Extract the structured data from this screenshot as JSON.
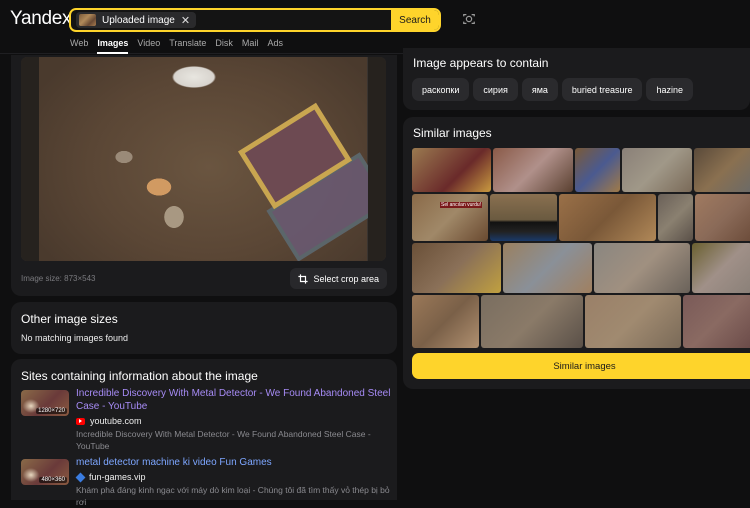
{
  "header": {
    "logo": "Yandex",
    "search_chip_label": "Uploaded image",
    "search_chip_close": "✕",
    "search_button": "Search",
    "nav": [
      "Web",
      "Images",
      "Video",
      "Translate",
      "Disk",
      "Mail",
      "Ads"
    ],
    "nav_active": "Images"
  },
  "main_image": {
    "size_label": "Image size: 873×543",
    "crop_button": "Select crop area"
  },
  "other_sizes": {
    "title": "Other image sizes",
    "message": "No matching images found"
  },
  "sites": {
    "title": "Sites containing information about the image",
    "items": [
      {
        "thumb_size": "1280×720",
        "title": "Incredible Discovery With Metal Detector - We Found Abandoned Steel Case - YouTube",
        "domain": "youtube.com",
        "domain_icon": "youtube-icon",
        "description": "Incredible Discovery With Metal Detector - We Found Abandoned Steel Case - YouTube",
        "visited": true
      },
      {
        "thumb_size": "480×360",
        "title": "metal detector machine ki video Fun Games",
        "domain": "fun-games.vip",
        "domain_icon": "diamond-icon",
        "description": "Khám phá đáng kinh ngạc với máy dò kim loại - Chúng tôi đã tìm thấy vỏ thép bị bỏ rơi",
        "visited": false
      }
    ]
  },
  "contains": {
    "title": "Image appears to contain",
    "tags": [
      "раскопки",
      "сирия",
      "яма",
      "buried treasure",
      "hazine"
    ]
  },
  "similar": {
    "title": "Similar images",
    "button": "Similar images",
    "tile_overlay_text": "Sel ancılan vurdu!"
  }
}
